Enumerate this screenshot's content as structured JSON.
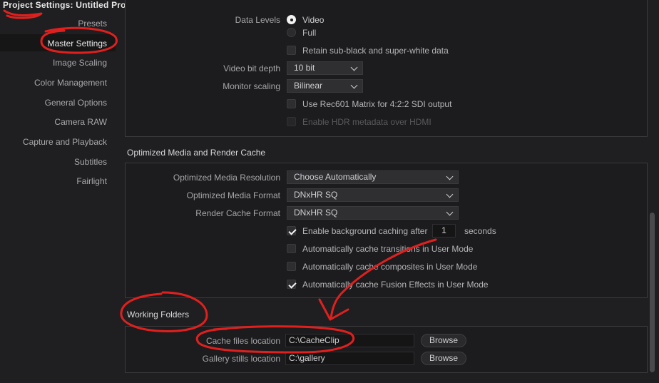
{
  "window": {
    "title": "Project Settings:  Untitled Project"
  },
  "sidebar": {
    "items": [
      {
        "label": "Presets",
        "active": false
      },
      {
        "label": "Master Settings",
        "active": true
      },
      {
        "label": "Image Scaling",
        "active": false
      },
      {
        "label": "Color Management",
        "active": false
      },
      {
        "label": "General Options",
        "active": false
      },
      {
        "label": "Camera RAW",
        "active": false
      },
      {
        "label": "Capture and Playback",
        "active": false
      },
      {
        "label": "Subtitles",
        "active": false
      },
      {
        "label": "Fairlight",
        "active": false
      }
    ]
  },
  "video_format": {
    "data_levels_label": "Data Levels",
    "data_levels_options": [
      {
        "label": "Video",
        "selected": true
      },
      {
        "label": "Full",
        "selected": false
      }
    ],
    "retain_label": "Retain sub-black and super-white data",
    "retain_checked": false,
    "bit_depth_label": "Video bit depth",
    "bit_depth_value": "10 bit",
    "monitor_scaling_label": "Monitor scaling",
    "monitor_scaling_value": "Bilinear",
    "rec601_label": "Use Rec601 Matrix for 4:2:2 SDI output",
    "rec601_checked": false,
    "hdr_label": "Enable HDR metadata over HDMI",
    "hdr_enabled": false
  },
  "optimized_media": {
    "section_title": "Optimized Media and Render Cache",
    "resolution_label": "Optimized Media Resolution",
    "resolution_value": "Choose Automatically",
    "format_label": "Optimized Media Format",
    "format_value": "DNxHR SQ",
    "render_format_label": "Render Cache Format",
    "render_format_value": "DNxHR SQ",
    "bg_caching_label": "Enable background caching after",
    "bg_caching_checked": true,
    "bg_caching_seconds": "1",
    "seconds_label": "seconds",
    "cache_transitions_label": "Automatically cache transitions in User Mode",
    "cache_transitions_checked": false,
    "cache_composites_label": "Automatically cache composites in User Mode",
    "cache_composites_checked": false,
    "cache_fusion_label": "Automatically cache Fusion Effects in User Mode",
    "cache_fusion_checked": true
  },
  "working_folders": {
    "section_title": "Working Folders",
    "cache_location_label": "Cache files location",
    "cache_location_value": "C:\\CacheClip",
    "gallery_location_label": "Gallery stills location",
    "gallery_location_value": "C:\\gallery",
    "browse_label": "Browse"
  },
  "annotation_color": "#e0201e"
}
